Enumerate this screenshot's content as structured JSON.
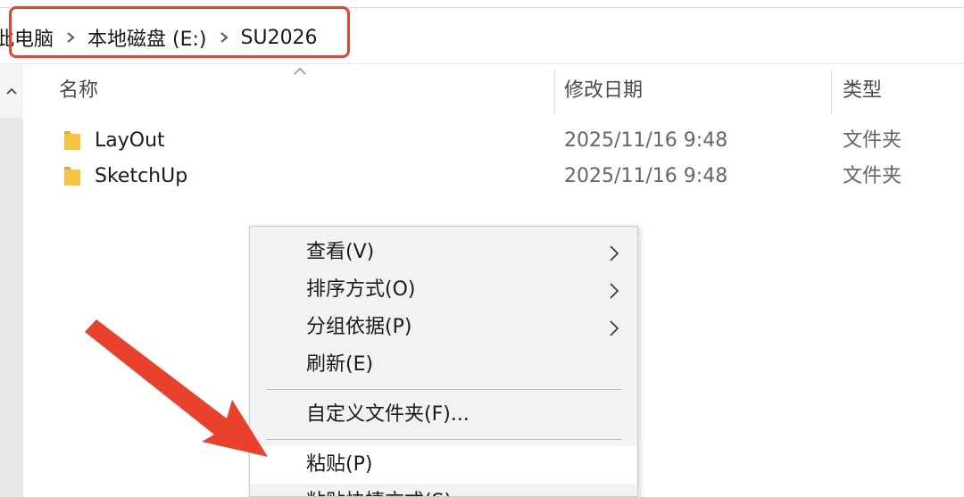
{
  "address_bar": {
    "crumbs": [
      "此电脑",
      "本地磁盘 (E:)",
      "SU2026"
    ]
  },
  "columns": {
    "name": "名称",
    "modified": "修改日期",
    "type": "类型"
  },
  "files": [
    {
      "name": "LayOut",
      "modified": "2025/11/16 9:48",
      "type": "文件夹"
    },
    {
      "name": "SketchUp",
      "modified": "2025/11/16 9:48",
      "type": "文件夹"
    }
  ],
  "context_menu": {
    "items": [
      {
        "label": "查看(V)",
        "has_submenu": true
      },
      {
        "label": "排序方式(O)",
        "has_submenu": true
      },
      {
        "label": "分组依据(P)",
        "has_submenu": true
      },
      {
        "label": "刷新(E)",
        "has_submenu": false
      },
      {
        "label": "自定义文件夹(F)...",
        "has_submenu": false
      },
      {
        "label": "粘贴(P)",
        "has_submenu": false,
        "highlighted": true
      },
      {
        "label": "粘贴快捷方式(S)",
        "has_submenu": false
      }
    ]
  },
  "colors": {
    "annotation_red": "#e8412c",
    "folder_yellow": "#f5c542"
  }
}
